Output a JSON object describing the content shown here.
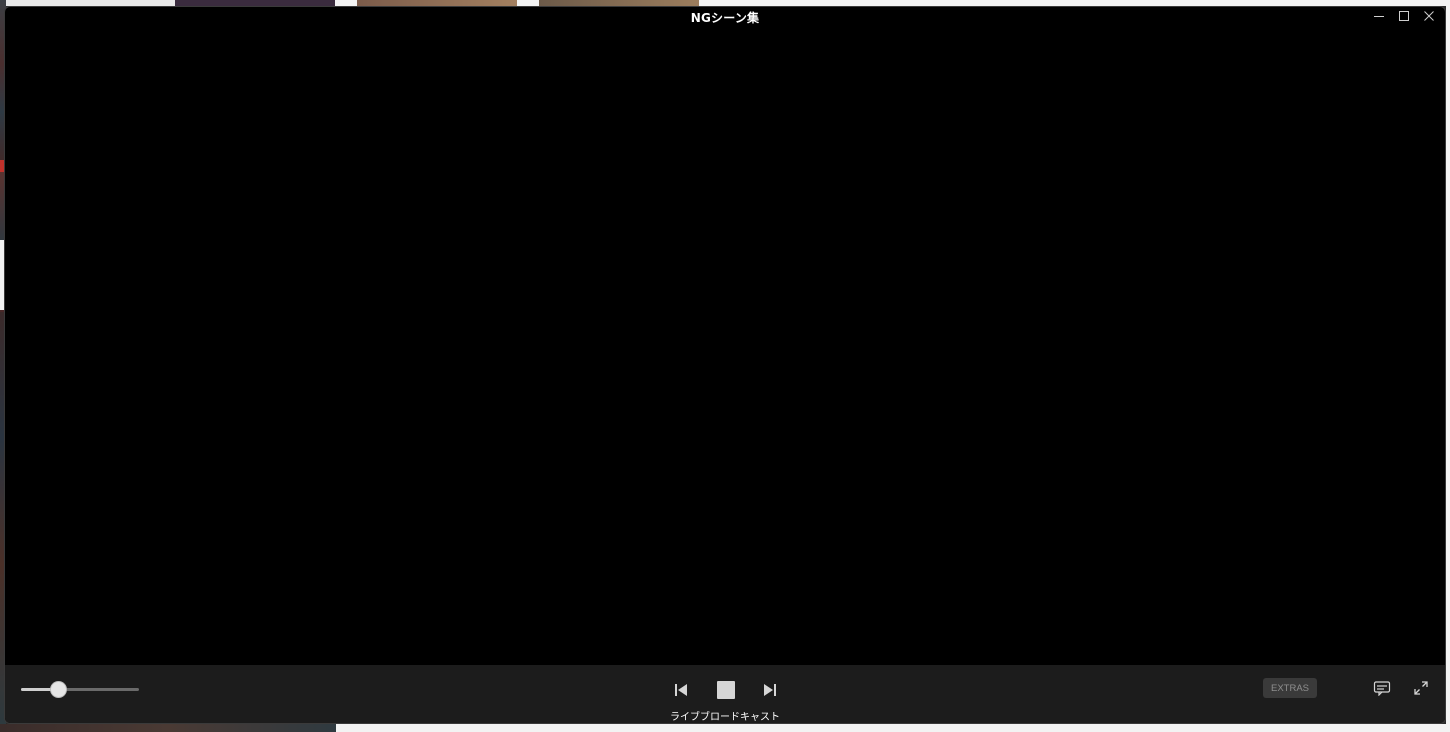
{
  "window": {
    "title": "NGシーン集"
  },
  "window_controls": {
    "minimize_icon": "minimize-icon",
    "maximize_icon": "maximize-icon",
    "close_icon": "close-icon"
  },
  "player": {
    "volume_level": 0.31,
    "now_playing": "ライブブロードキャスト",
    "extras_label": "EXTRAS",
    "icons": {
      "previous": "skip-previous-icon",
      "stop": "stop-icon",
      "next": "skip-next-icon",
      "subtitles": "subtitles-icon",
      "fullscreen": "fullscreen-icon"
    }
  },
  "colors": {
    "video_background": "#000000",
    "controlbar_background": "#1c1c1c",
    "icon_color": "#d6d6d6",
    "extras_background": "#3a3a3a",
    "extras_text": "#8e8e8e"
  }
}
